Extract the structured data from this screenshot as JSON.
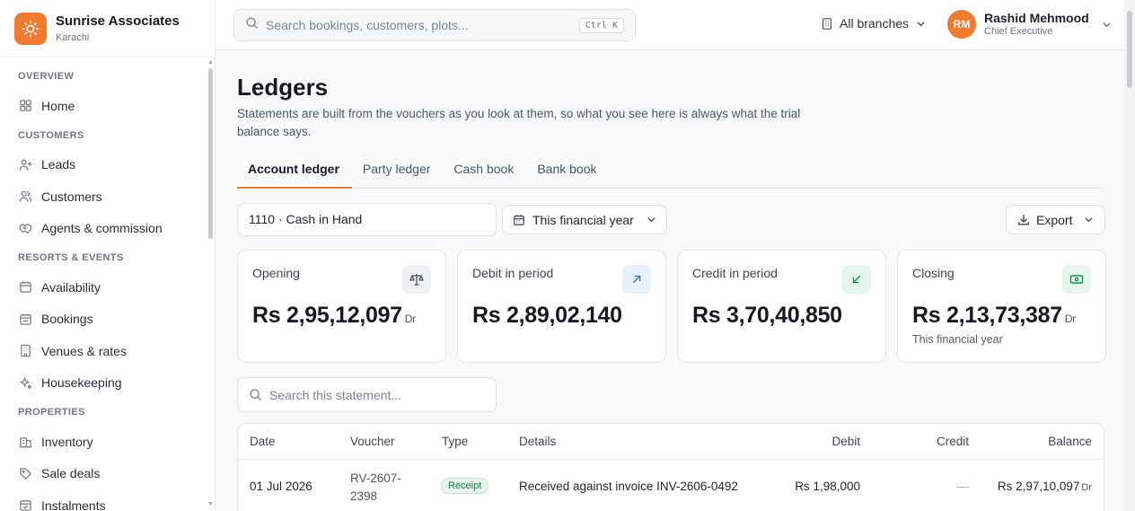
{
  "brand": {
    "name": "Sunrise Associates",
    "city": "Karachi",
    "accent": "#f07a2e"
  },
  "sidebar": {
    "sections": [
      {
        "label": "OVERVIEW",
        "items": [
          {
            "label": "Home",
            "icon": "grid-icon"
          }
        ]
      },
      {
        "label": "CUSTOMERS",
        "items": [
          {
            "label": "Leads",
            "icon": "user-plus-icon"
          },
          {
            "label": "Customers",
            "icon": "users-icon"
          },
          {
            "label": "Agents & commission",
            "icon": "handshake-icon"
          }
        ]
      },
      {
        "label": "RESORTS & EVENTS",
        "items": [
          {
            "label": "Availability",
            "icon": "calendar-icon"
          },
          {
            "label": "Bookings",
            "icon": "book-icon"
          },
          {
            "label": "Venues & rates",
            "icon": "building-icon"
          },
          {
            "label": "Housekeeping",
            "icon": "sparkles-icon"
          }
        ]
      },
      {
        "label": "PROPERTIES",
        "items": [
          {
            "label": "Inventory",
            "icon": "buildings-icon"
          },
          {
            "label": "Sale deals",
            "icon": "tag-icon"
          },
          {
            "label": "Instalments",
            "icon": "calendar-check-icon"
          }
        ]
      }
    ]
  },
  "topbar": {
    "search_placeholder": "Search bookings, customers, plots...",
    "shortcut": "Ctrl K",
    "branches": "All branches",
    "user": {
      "initials": "RM",
      "name": "Rashid Mehmood",
      "role": "Chief Executive"
    }
  },
  "page": {
    "title": "Ledgers",
    "subtitle": "Statements are built from the vouchers as you look at them, so what you see here is always what the trial balance says.",
    "tabs": [
      "Account ledger",
      "Party ledger",
      "Cash book",
      "Bank book"
    ],
    "active_tab": "Account ledger",
    "account": "1110 · Cash in Hand",
    "period": "This financial year",
    "export": "Export",
    "statement_search_placeholder": "Search this statement..."
  },
  "cards": [
    {
      "label": "Opening",
      "value": "Rs 2,95,12,097",
      "suffix": "Dr",
      "note": "",
      "icon": "scale-icon",
      "icon_bg": "#eef0f3",
      "icon_color": "#4b5260"
    },
    {
      "label": "Debit in period",
      "value": "Rs 2,89,02,140",
      "suffix": "",
      "note": "",
      "icon": "arrow-up-right-icon",
      "icon_bg": "#e8f1fc",
      "icon_color": "#2f6fd0"
    },
    {
      "label": "Credit in period",
      "value": "Rs 3,70,40,850",
      "suffix": "",
      "note": "",
      "icon": "arrow-down-left-icon",
      "icon_bg": "#e6f6ef",
      "icon_color": "#1e8a5a"
    },
    {
      "label": "Closing",
      "value": "Rs 2,13,73,387",
      "suffix": "Dr",
      "note": "This financial year",
      "icon": "banknote-icon",
      "icon_bg": "#e6f6ef",
      "icon_color": "#1e8a5a"
    }
  ],
  "table": {
    "columns": [
      "Date",
      "Voucher",
      "Type",
      "Details",
      "Debit",
      "Credit",
      "Balance"
    ],
    "rows": [
      {
        "date": "01 Jul 2026",
        "voucher_line1": "RV-2607-",
        "voucher_line2": "2398",
        "type": "Receipt",
        "details": "Received against invoice INV-2606-0492",
        "debit": "Rs 1,98,000",
        "credit": "—",
        "balance": "Rs 2,97,10,097",
        "balance_suffix": "Dr"
      }
    ]
  }
}
